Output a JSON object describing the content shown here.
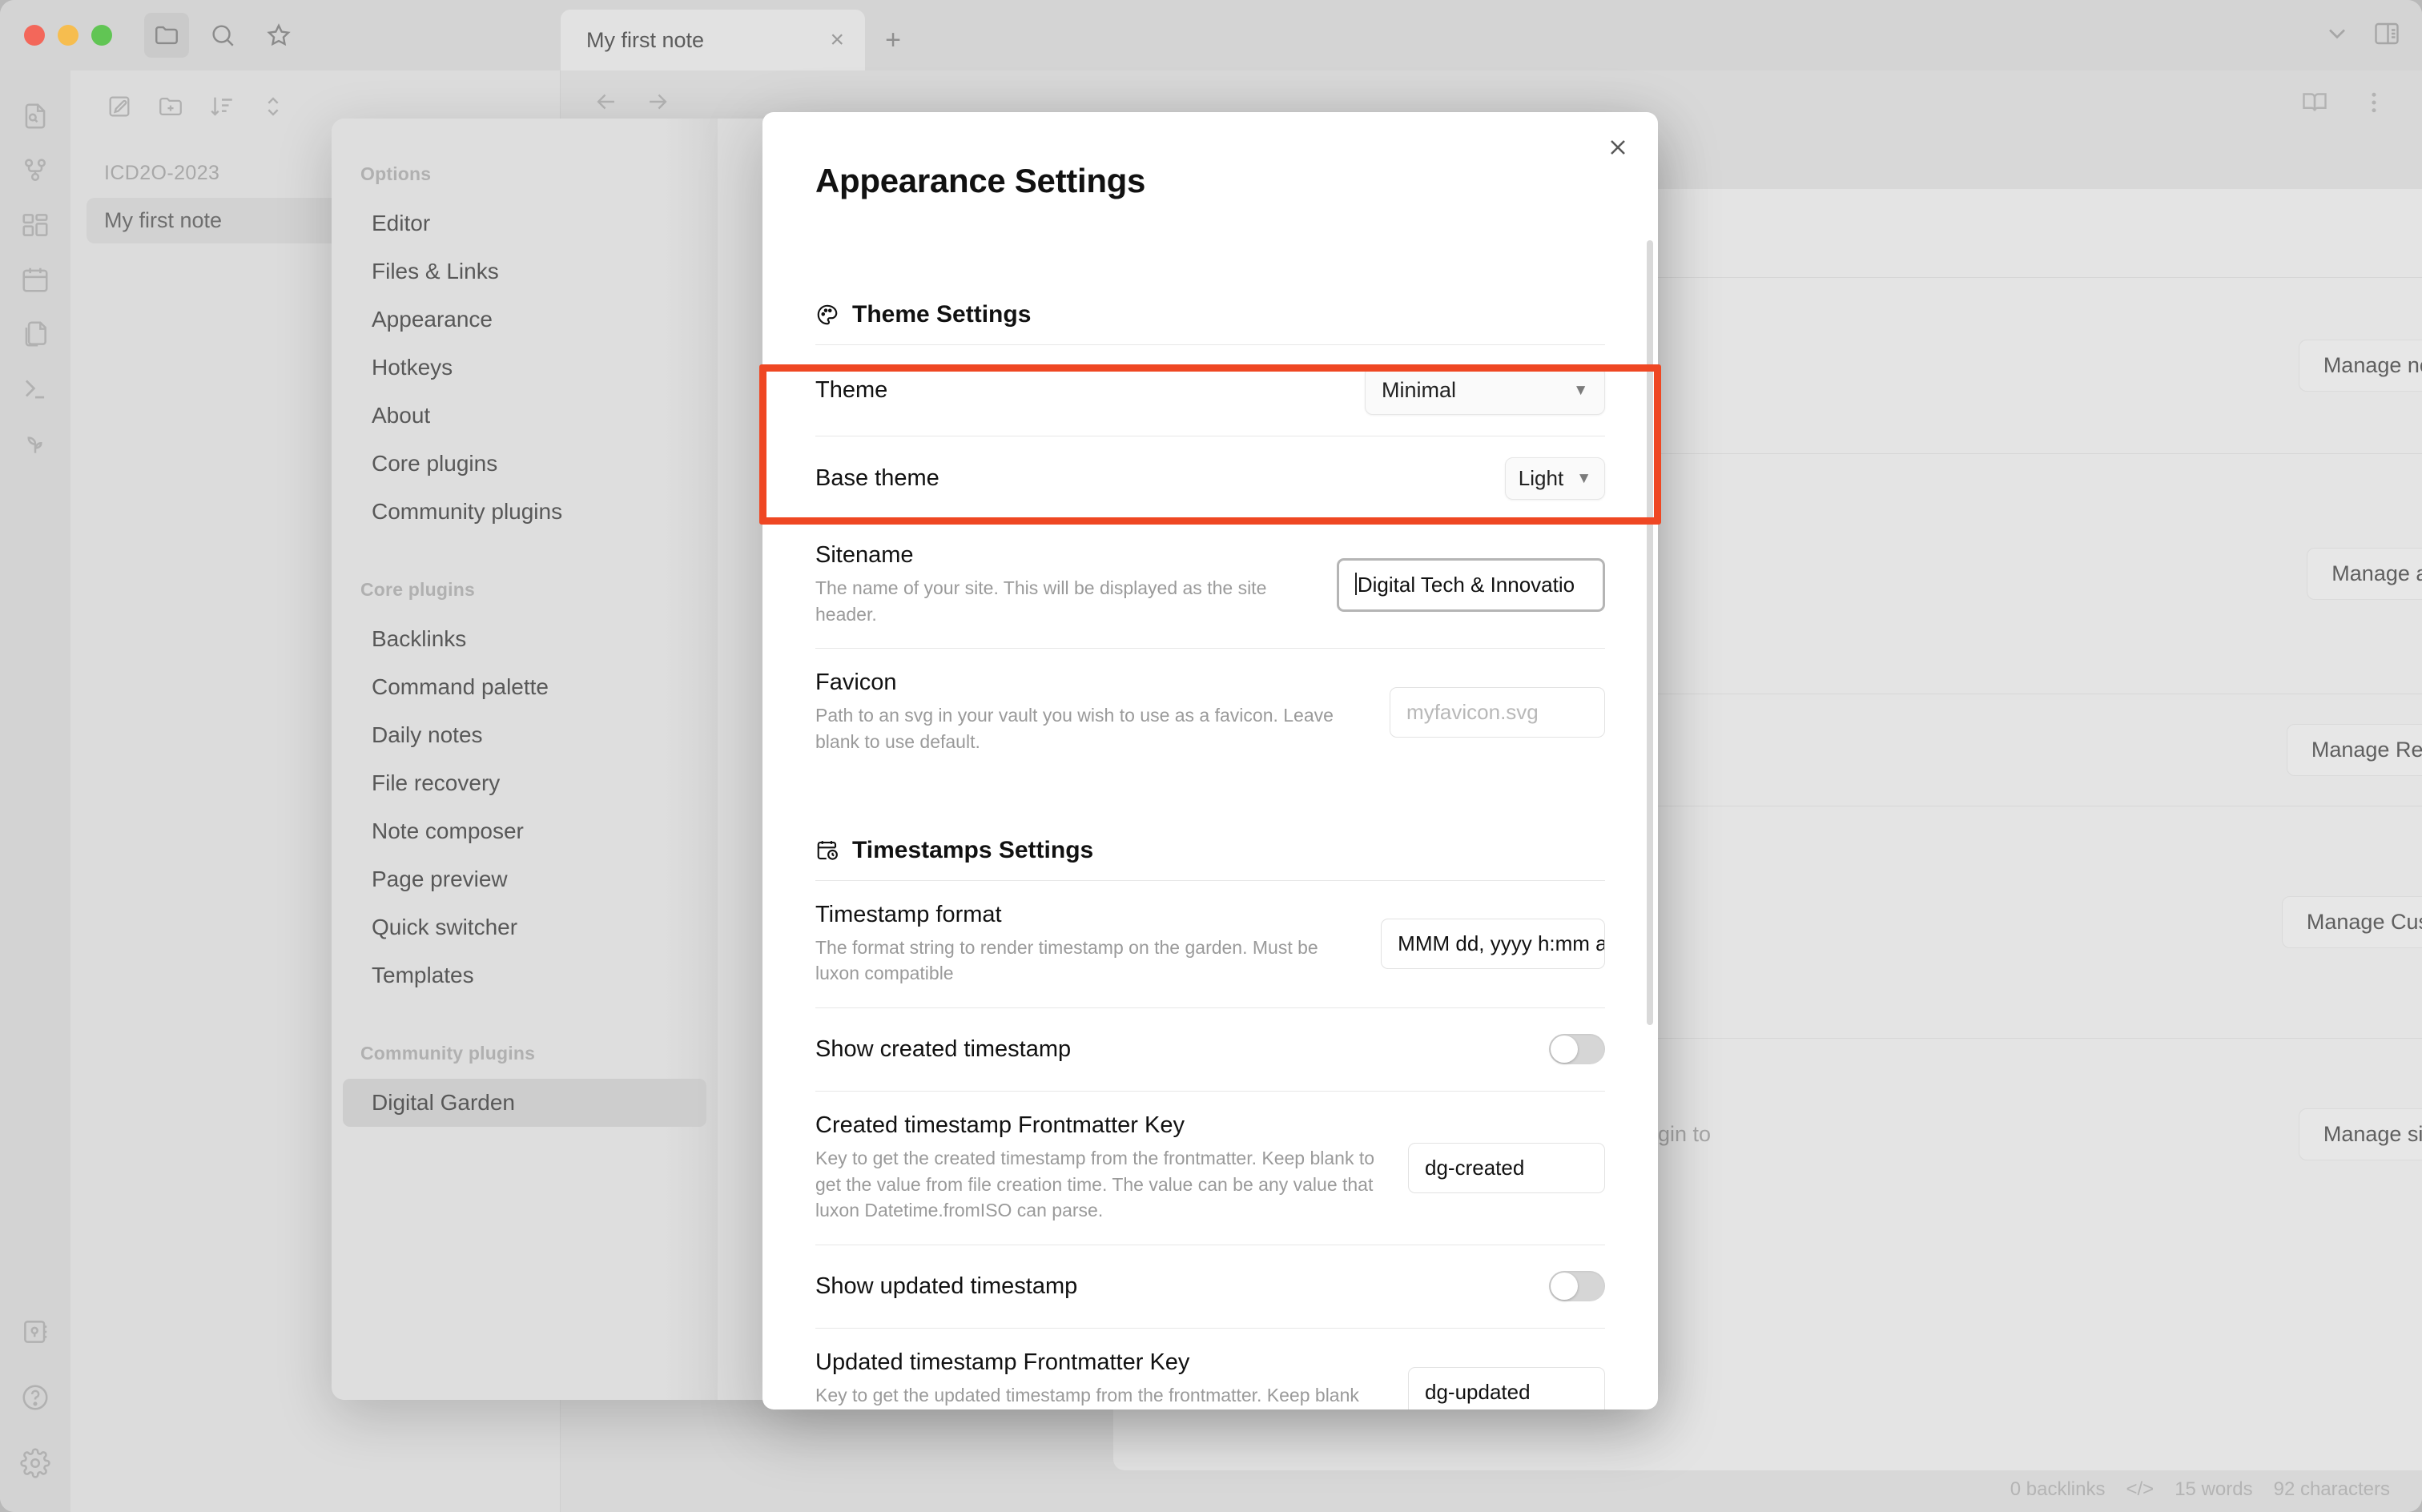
{
  "window": {
    "traffic_lights": [
      "close",
      "minimize",
      "zoom"
    ],
    "toolbar_icons": [
      "folder-icon",
      "search-icon",
      "star-icon"
    ],
    "right_icons": [
      "chevron-down-icon",
      "split-layout-icon"
    ]
  },
  "tabs": {
    "items": [
      {
        "title": "My first note",
        "close": "×"
      }
    ],
    "new_tab": "+"
  },
  "ribbon": {
    "icons": [
      "file-search-icon",
      "graph-icon",
      "canvas-icon",
      "calendar-icon",
      "copy-file-icon",
      "terminal-icon",
      "seedling-icon"
    ],
    "bottom_icons": [
      "vault-icon",
      "help-icon",
      "gear-icon"
    ]
  },
  "file_pane": {
    "toolbar_icons": [
      "new-note-icon",
      "new-folder-icon",
      "sort-icon",
      "collapse-icon"
    ],
    "folder": "ICD2O-2023",
    "files": [
      {
        "name": "My first note"
      }
    ]
  },
  "editor": {
    "nav_icons": [
      "back-arrow-icon",
      "forward-arrow-icon"
    ],
    "right_icons": [
      "reading-view-icon",
      "more-options-icon"
    ]
  },
  "background_panel": {
    "close": "×",
    "buttons": [
      {
        "label": "Manage note settings"
      },
      {
        "label": "Manage appearance"
      },
      {
        "label": "Manage Rewrite Rules"
      },
      {
        "label": "Manage Custom Filters"
      },
      {
        "label": "Manage site template"
      }
    ],
    "clipped_text": "gin to"
  },
  "settings_sidebar": {
    "groups": [
      {
        "header": "Options",
        "items": [
          {
            "label": "Editor",
            "selected": false
          },
          {
            "label": "Files & Links",
            "selected": false
          },
          {
            "label": "Appearance",
            "selected": false
          },
          {
            "label": "Hotkeys",
            "selected": false
          },
          {
            "label": "About",
            "selected": false
          },
          {
            "label": "Core plugins",
            "selected": false
          },
          {
            "label": "Community plugins",
            "selected": false
          }
        ]
      },
      {
        "header": "Core plugins",
        "items": [
          {
            "label": "Backlinks",
            "selected": false
          },
          {
            "label": "Command palette",
            "selected": false
          },
          {
            "label": "Daily notes",
            "selected": false
          },
          {
            "label": "File recovery",
            "selected": false
          },
          {
            "label": "Note composer",
            "selected": false
          },
          {
            "label": "Page preview",
            "selected": false
          },
          {
            "label": "Quick switcher",
            "selected": false
          },
          {
            "label": "Templates",
            "selected": false
          }
        ]
      },
      {
        "header": "Community plugins",
        "items": [
          {
            "label": "Digital Garden",
            "selected": true
          }
        ]
      }
    ]
  },
  "dialog": {
    "title": "Appearance Settings",
    "close": "×",
    "sections": [
      {
        "icon": "palette-icon",
        "heading": "Theme Settings",
        "rows": [
          {
            "name": "Theme",
            "desc": "",
            "control": "select",
            "value": "Minimal",
            "arrow": "▼"
          },
          {
            "name": "Base theme",
            "desc": "",
            "control": "select-small",
            "value": "Light",
            "arrow": "▼"
          },
          {
            "name": "Sitename",
            "desc": "The name of your site. This will be displayed as the site header.",
            "control": "text-focused",
            "value": "Digital Tech & Innovatio",
            "placeholder": ""
          },
          {
            "name": "Favicon",
            "desc": "Path to an svg in your vault you wish to use as a favicon. Leave blank to use default.",
            "control": "text",
            "value": "",
            "placeholder": "myfavicon.svg"
          }
        ]
      },
      {
        "icon": "calendar-clock-icon",
        "heading": "Timestamps Settings",
        "rows": [
          {
            "name": "Timestamp format",
            "desc": "The format string to render timestamp on the garden. Must be luxon compatible",
            "control": "text",
            "value": "MMM dd, yyyy h:mm a",
            "placeholder": ""
          },
          {
            "name": "Show created timestamp",
            "desc": "",
            "control": "toggle",
            "value": "off"
          },
          {
            "name": "Created timestamp Frontmatter Key",
            "desc": "Key to get the created timestamp from the frontmatter. Keep blank to get the value from file creation time. The value can be any value that luxon Datetime.fromISO can parse.",
            "control": "text",
            "value": "dg-created",
            "placeholder": ""
          },
          {
            "name": "Show updated timestamp",
            "desc": "",
            "control": "toggle",
            "value": "off"
          },
          {
            "name": "Updated timestamp Frontmatter Key",
            "desc": "Key to get the updated timestamp from the frontmatter. Keep blank to get the value from file update time. The value can be any",
            "control": "text",
            "value": "dg-updated",
            "placeholder": ""
          }
        ]
      }
    ]
  },
  "highlight": {
    "color": "#ef4723",
    "label": "theme-settings-highlight"
  },
  "statusbar": {
    "backlinks": "0 backlinks",
    "code_icon": "</>",
    "words": "15 words",
    "characters": "92 characters"
  }
}
